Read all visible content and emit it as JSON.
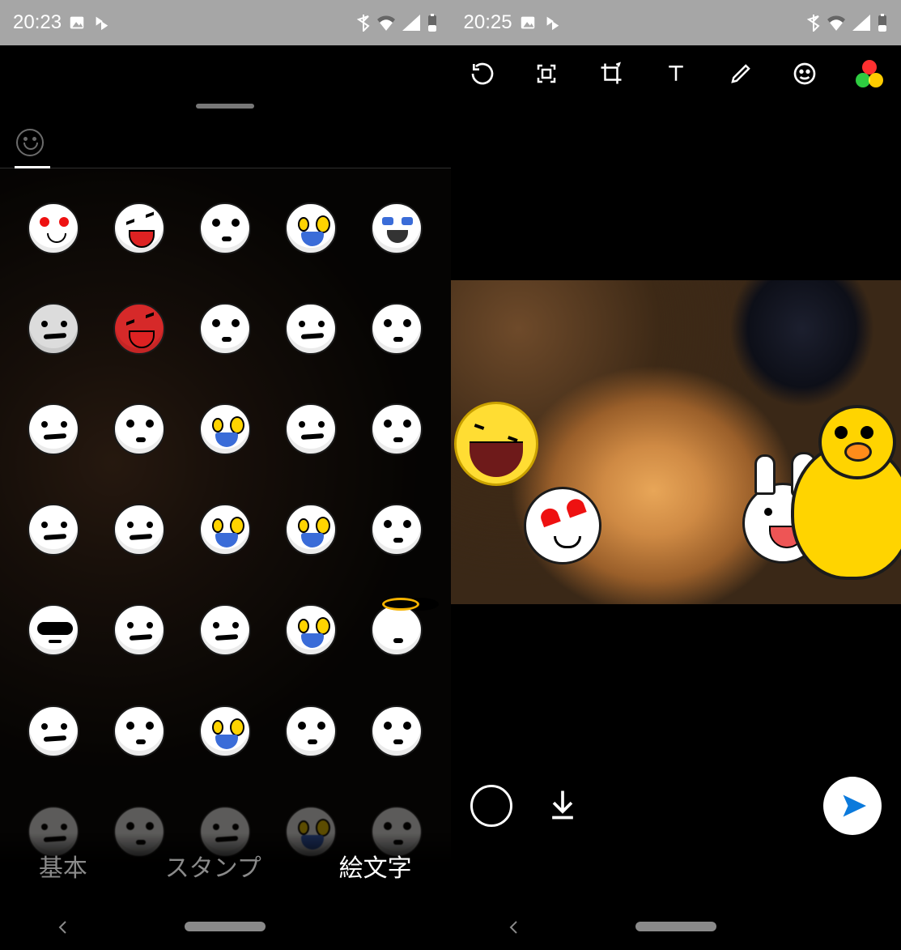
{
  "left": {
    "status": {
      "time": "20:23"
    },
    "bottom_tabs": {
      "basic": "基本",
      "stamp": "スタンプ",
      "emoji": "絵文字",
      "active": "emoji"
    },
    "stickers": [
      {
        "id": "heart-eyes",
        "cls": "f1"
      },
      {
        "id": "laughing",
        "cls": "f2"
      },
      {
        "id": "pleading",
        "cls": "f3"
      },
      {
        "id": "scream-sweat",
        "cls": "f4"
      },
      {
        "id": "crying-loud",
        "cls": "f5"
      },
      {
        "id": "skull",
        "cls": "f6",
        "extra": "gray"
      },
      {
        "id": "angry-red",
        "cls": "f2",
        "extra": "red"
      },
      {
        "id": "grimace",
        "cls": "f3"
      },
      {
        "id": "wince",
        "cls": "f6"
      },
      {
        "id": "wink-sweat",
        "cls": "f3"
      },
      {
        "id": "dizzy",
        "cls": "f6"
      },
      {
        "id": "awkward",
        "cls": "f3"
      },
      {
        "id": "shocked-blue",
        "cls": "f4"
      },
      {
        "id": "weary",
        "cls": "f6"
      },
      {
        "id": "nervous",
        "cls": "f3"
      },
      {
        "id": "furious",
        "cls": "f6"
      },
      {
        "id": "grumpy",
        "cls": "f6"
      },
      {
        "id": "wailing",
        "cls": "f4"
      },
      {
        "id": "tears",
        "cls": "f4"
      },
      {
        "id": "surprised",
        "cls": "f3"
      },
      {
        "id": "sunglasses",
        "cls": "fsun"
      },
      {
        "id": "sad",
        "cls": "f6"
      },
      {
        "id": "worried",
        "cls": "f6"
      },
      {
        "id": "anxious-sweat",
        "cls": "f4"
      },
      {
        "id": "angel",
        "cls": "f3 fhalo"
      },
      {
        "id": "mask",
        "cls": "f6"
      },
      {
        "id": "delighted",
        "cls": "f3"
      },
      {
        "id": "cold-sweat",
        "cls": "f4"
      },
      {
        "id": "astonished",
        "cls": "f3"
      },
      {
        "id": "kiss",
        "cls": "f3"
      },
      {
        "id": "fade1",
        "cls": "f6",
        "extra": "fade"
      },
      {
        "id": "fade2",
        "cls": "f3",
        "extra": "fade"
      },
      {
        "id": "fade3",
        "cls": "f6",
        "extra": "fade"
      },
      {
        "id": "fade4",
        "cls": "f4",
        "extra": "fade"
      },
      {
        "id": "fade5",
        "cls": "f3",
        "extra": "fade"
      }
    ]
  },
  "right": {
    "status": {
      "time": "20:25"
    },
    "toolbar": {
      "rotate": "rotate-icon",
      "frame": "frame-icon",
      "crop": "crop-icon",
      "text": "text-icon",
      "draw": "pencil-icon",
      "sticker": "sticker-face-icon",
      "filter": "color-filter-icon"
    },
    "overlays": [
      {
        "id": "big-laugh-sticker"
      },
      {
        "id": "heart-eyes-sticker"
      },
      {
        "id": "bunny-sticker"
      },
      {
        "id": "duck-sticker"
      }
    ],
    "actions": {
      "record": "record-button",
      "download": "download-button",
      "send": "send-button"
    }
  }
}
